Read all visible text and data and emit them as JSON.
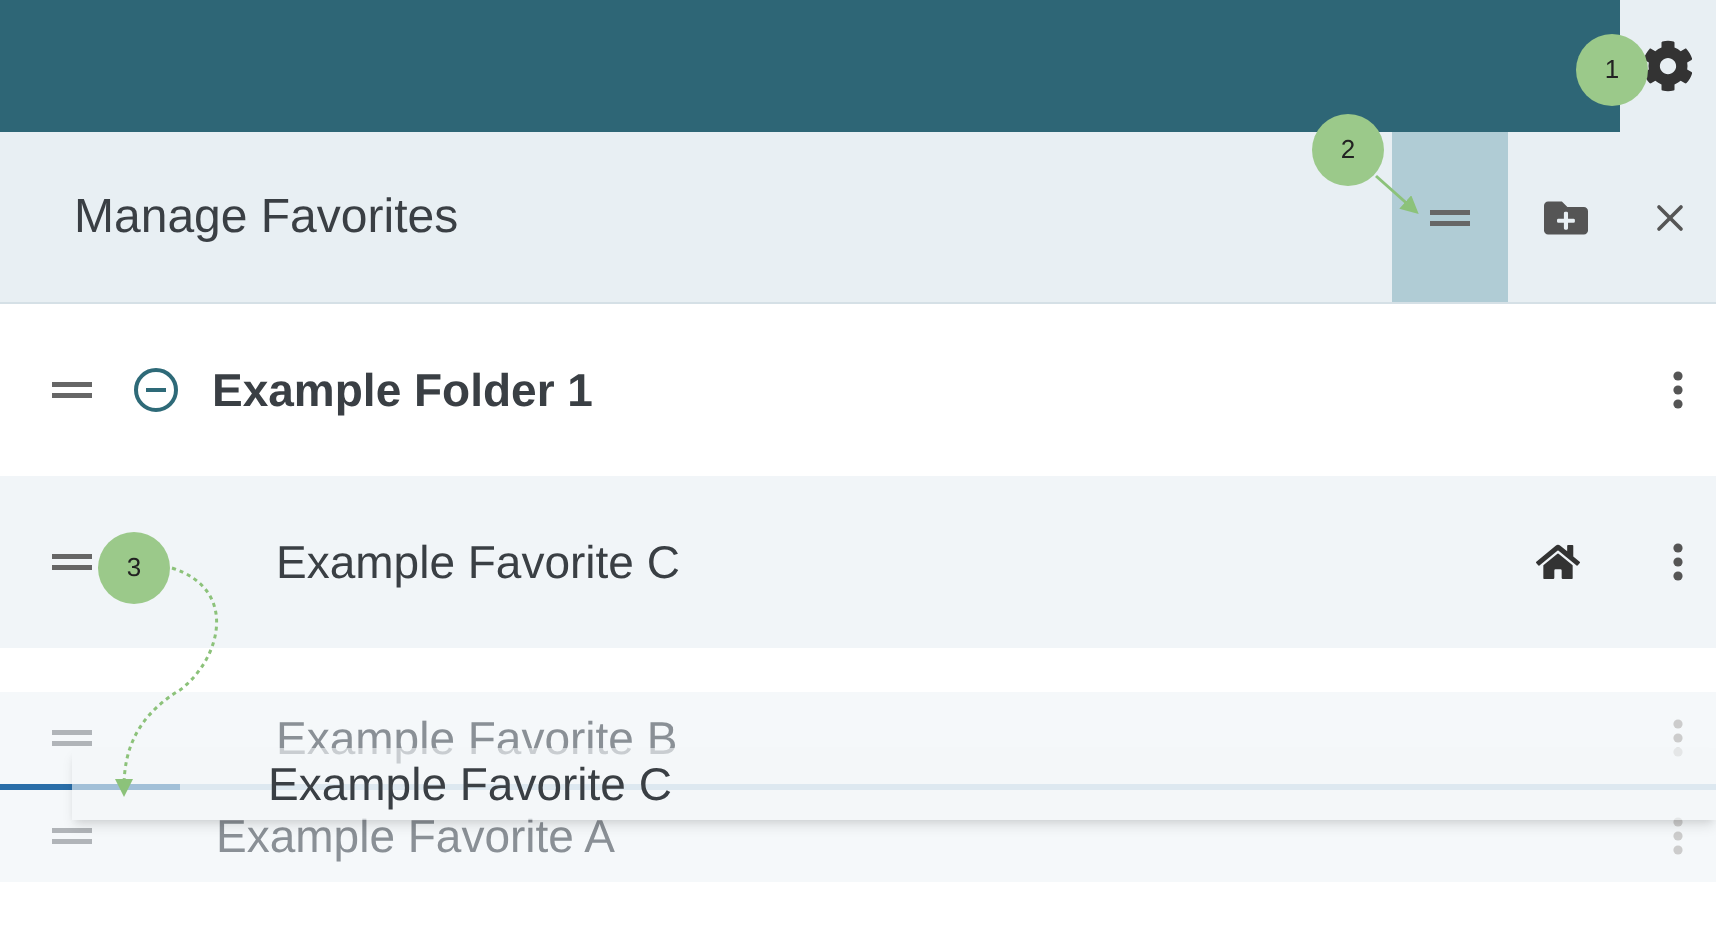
{
  "header": {
    "title": "Manage Favorites",
    "reorder_selected": true
  },
  "items": [
    {
      "kind": "folder",
      "label": "Example Folder 1",
      "expanded": true,
      "faded": false,
      "highlighted": false
    },
    {
      "kind": "favorite",
      "label": "Example Favorite C",
      "faded": false,
      "home": true,
      "highlighted": true
    },
    {
      "kind": "favorite",
      "label": "Example Favorite B",
      "faded": true,
      "highlighted": false
    },
    {
      "kind": "favorite",
      "label": "Example Favorite A",
      "faded": true,
      "highlighted": false
    }
  ],
  "drag_ghost": {
    "label": "Example Favorite C"
  },
  "callouts": [
    {
      "label": "1"
    },
    {
      "label": "2"
    },
    {
      "label": "3"
    }
  ]
}
